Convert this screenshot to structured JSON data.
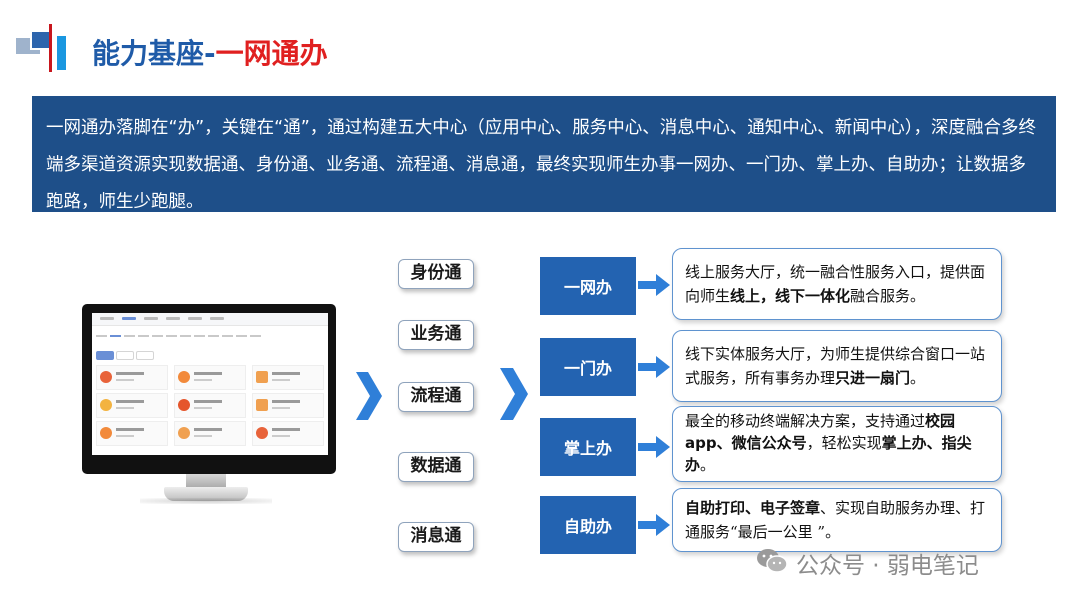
{
  "header": {
    "title_main": "能力基座-",
    "title_accent": "一网通办"
  },
  "intro": {
    "text": "一网通办落脚在“办”，关键在“通”，通过构建五大中心（应用中心、服务中心、消息中心、通知中心、新闻中心），深度融合多终端多渠道资源实现数据通、身份通、业务通、流程通、消息通，最终实现师生办事一网办、一门办、掌上办、自助办；让数据多跑路，师生少跑腿。"
  },
  "channels": [
    "身份通",
    "业务通",
    "流程通",
    "数据通",
    "消息通"
  ],
  "services": [
    {
      "label": "一网办",
      "desc": [
        {
          "t": "线上服务大厅，统一融合性服务入口，提供面向师生",
          "b": false
        },
        {
          "t": "线上，线下一体化",
          "b": true
        },
        {
          "t": "融合服务。",
          "b": false
        }
      ]
    },
    {
      "label": "一门办",
      "desc": [
        {
          "t": "线下实体服务大厅，为师生提供综合窗口一站式服务，所有事务办理",
          "b": false
        },
        {
          "t": "只进一扇门",
          "b": true
        },
        {
          "t": "。",
          "b": false
        }
      ]
    },
    {
      "label": "掌上办",
      "desc": [
        {
          "t": "最全的移动终端解决方案，支持通过",
          "b": false
        },
        {
          "t": "校园app、微信公众号",
          "b": true
        },
        {
          "t": "，轻松实现",
          "b": false
        },
        {
          "t": "掌上办、指尖办",
          "b": true
        },
        {
          "t": "。",
          "b": false
        }
      ]
    },
    {
      "label": "自助办",
      "desc": [
        {
          "t": "自助打印、电子签章",
          "b": true
        },
        {
          "t": "、实现自助服务办理、打通服务“最后一公里 ”。",
          "b": false
        }
      ]
    }
  ],
  "watermark": {
    "text": "公众号 · 弱电笔记",
    "icon": "wechat-icon"
  },
  "colors": {
    "brand_blue": "#1f5ba8",
    "accent_red": "#e02020",
    "intro_bg": "#1e4f89",
    "service_bg": "#2363b1",
    "arrow_blue": "#2f7fd8"
  }
}
